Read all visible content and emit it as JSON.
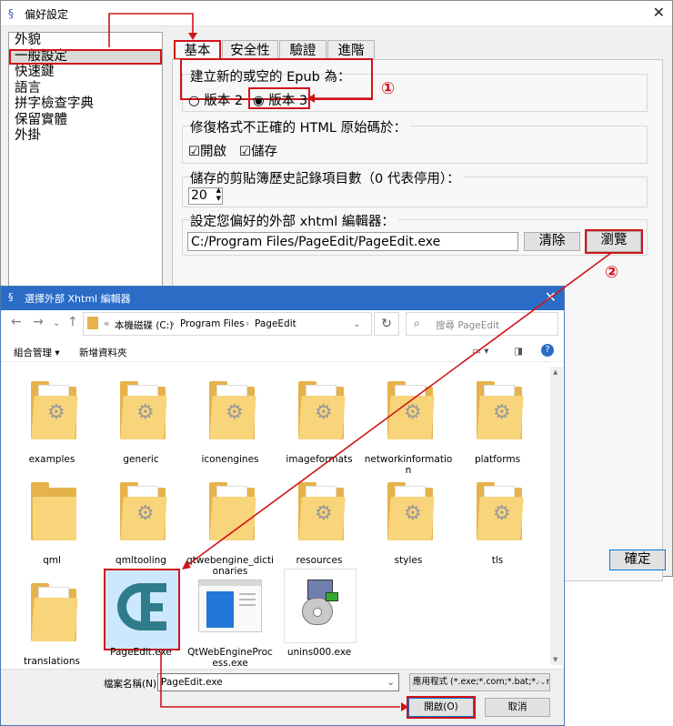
{
  "prefs": {
    "title": "偏好設定",
    "categories": [
      "外貌",
      "一般設定",
      "快速鍵",
      "語言",
      "拼字檢查字典",
      "保留實體",
      "外掛"
    ],
    "tabs": [
      "基本",
      "安全性",
      "驗證",
      "進階"
    ],
    "epub_label": "建立新的或空的 Epub 為：",
    "epub_v2": "版本 2",
    "epub_v3": "版本 3",
    "html_fix_label": "修復格式不正確的 HTML 原始碼於：",
    "html_fix_open": "開啟",
    "html_fix_save": "儲存",
    "clipboard_label": "儲存的剪貼簿歷史記錄項目數（0 代表停用）：",
    "clipboard_value": "20",
    "xhtml_label": "設定您偏好的外部 xhtml 編輯器：",
    "xhtml_path": "C:/Program Files/PageEdit/PageEdit.exe",
    "clear_button": "清除",
    "browse_button": "瀏覽",
    "ok_button": "確定",
    "callout1": "①",
    "callout2": "②"
  },
  "filedlg": {
    "title": "選擇外部 Xhtml 編輯器",
    "breadcrumb": [
      "本機磁碟 (C:)",
      "Program Files",
      "PageEdit"
    ],
    "search_placeholder": "搜尋 PageEdit",
    "organize": "組合管理 ▾",
    "new_folder": "新增資料夾",
    "files": [
      {
        "name": "examples",
        "kind": "gear-folder"
      },
      {
        "name": "generic",
        "kind": "gear-folder"
      },
      {
        "name": "iconengines",
        "kind": "gear-folder"
      },
      {
        "name": "imageformats",
        "kind": "gear-folder"
      },
      {
        "name": "networkinformation",
        "kind": "gear-folder"
      },
      {
        "name": "platforms",
        "kind": "gear-folder"
      },
      {
        "name": "qml",
        "kind": "folder"
      },
      {
        "name": "qmltooling",
        "kind": "gear-folder"
      },
      {
        "name": "qtwebengine_dictionaries",
        "kind": "folder"
      },
      {
        "name": "resources",
        "kind": "gear-folder"
      },
      {
        "name": "styles",
        "kind": "gear-folder"
      },
      {
        "name": "tls",
        "kind": "gear-folder"
      },
      {
        "name": "translations",
        "kind": "folder"
      },
      {
        "name": "PageEdit.exe",
        "kind": "pageedit"
      },
      {
        "name": "QtWebEngineProcess.exe",
        "kind": "window-exe"
      },
      {
        "name": "unins000.exe",
        "kind": "installer-exe"
      }
    ],
    "filename_label": "檔案名稱(N):",
    "filename_value": "PageEdit.exe",
    "filter_value": "應用程式 (*.exe;*.com;*.bat;*.cm",
    "open_button": "開啟(O)",
    "cancel_button": "取消"
  }
}
